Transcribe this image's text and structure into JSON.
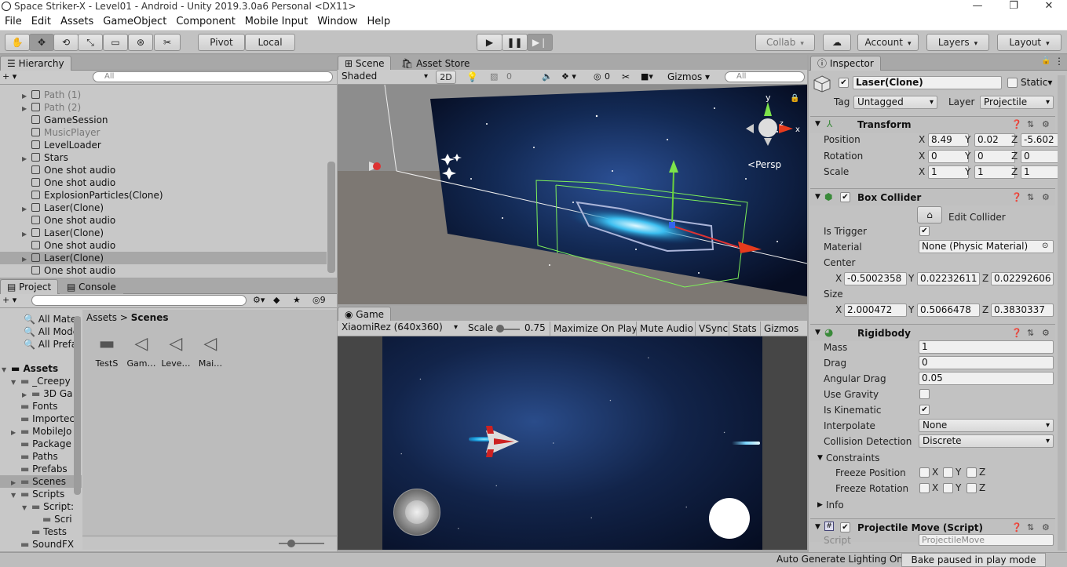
{
  "window": {
    "title": "Space Striker-X - Level01 - Android - Unity 2019.3.0a6 Personal <DX11>",
    "min": "—",
    "max": "❐",
    "close": "✕"
  },
  "menu": [
    "File",
    "Edit",
    "Assets",
    "GameObject",
    "Component",
    "Mobile Input",
    "Window",
    "Help"
  ],
  "toolbar": {
    "pivot": "Pivot",
    "local": "Local",
    "collab": "Collab",
    "account": "Account",
    "layers": "Layers",
    "layout": "Layout",
    "tools": [
      "✋",
      "✥",
      "⟲",
      "⤡",
      "▭",
      "⊛",
      "✂"
    ],
    "play": "▶",
    "pause": "❚❚",
    "step": "▶❘"
  },
  "hierarchy": {
    "tab": "Hierarchy",
    "create": "+ ▾",
    "search_placeholder": "All",
    "items": [
      {
        "label": "Path (1)",
        "arrow": "▶",
        "grey": true
      },
      {
        "label": "Path (2)",
        "arrow": "▶",
        "grey": true
      },
      {
        "label": "GameSession",
        "arrow": "",
        "grey": false
      },
      {
        "label": "MusicPlayer",
        "arrow": "",
        "grey": true
      },
      {
        "label": "LevelLoader",
        "arrow": "",
        "grey": false
      },
      {
        "label": "Stars",
        "arrow": "▶",
        "grey": false
      },
      {
        "label": "One shot audio",
        "arrow": "",
        "grey": false
      },
      {
        "label": "One shot audio",
        "arrow": "",
        "grey": false
      },
      {
        "label": "ExplosionParticles(Clone)",
        "arrow": "",
        "grey": false
      },
      {
        "label": "Laser(Clone)",
        "arrow": "▶",
        "grey": false
      },
      {
        "label": "One shot audio",
        "arrow": "",
        "grey": false
      },
      {
        "label": "Laser(Clone)",
        "arrow": "▶",
        "grey": false
      },
      {
        "label": "One shot audio",
        "arrow": "",
        "grey": false
      },
      {
        "label": "Laser(Clone)",
        "arrow": "▶",
        "grey": false,
        "selected": true
      },
      {
        "label": "One shot audio",
        "arrow": "",
        "grey": false
      }
    ]
  },
  "project": {
    "tab": "Project",
    "console_tab": "Console",
    "hidden_count": "9",
    "favorites": [
      "All Mater",
      "All Mode",
      "All Prefa"
    ],
    "assets_root": "Assets",
    "tree": [
      {
        "label": "_Creepy",
        "arrow": "▼",
        "indent": 1
      },
      {
        "label": "3D Ga",
        "arrow": "▶",
        "indent": 2
      },
      {
        "label": "Fonts",
        "arrow": "",
        "indent": 1
      },
      {
        "label": "Importec",
        "arrow": "",
        "indent": 1
      },
      {
        "label": "MobileJo",
        "arrow": "▶",
        "indent": 1
      },
      {
        "label": "Package",
        "arrow": "",
        "indent": 1
      },
      {
        "label": "Paths",
        "arrow": "",
        "indent": 1
      },
      {
        "label": "Prefabs",
        "arrow": "",
        "indent": 1
      },
      {
        "label": "Scenes",
        "arrow": "▶",
        "indent": 1,
        "selected": true
      },
      {
        "label": "Scripts",
        "arrow": "▼",
        "indent": 1
      },
      {
        "label": "Script:",
        "arrow": "▼",
        "indent": 2
      },
      {
        "label": "Scri",
        "arrow": "",
        "indent": 3
      },
      {
        "label": "Tests",
        "arrow": "",
        "indent": 2
      },
      {
        "label": "SoundFX",
        "arrow": "",
        "indent": 1
      }
    ],
    "breadcrumb_root": "Assets",
    "breadcrumb_sep": ">",
    "breadcrumb_current": "Scenes",
    "files": [
      {
        "label": "TestS",
        "kind": "folder"
      },
      {
        "label": "Gam…",
        "kind": "unity"
      },
      {
        "label": "Leve…",
        "kind": "unity"
      },
      {
        "label": "Mai…",
        "kind": "unity"
      }
    ]
  },
  "scene": {
    "tab": "Scene",
    "store_tab": "Asset Store",
    "shading": "Shaded",
    "mode_2d": "2D",
    "fx_count": "0",
    "hidden": "0",
    "gizmos": "Gizmos",
    "search_placeholder": "All",
    "persp": "Persp",
    "axis_y": "y",
    "axis_x": "x",
    "axis_z": "z"
  },
  "game": {
    "tab": "Game",
    "resolution": "XiaomiRez (640x360)",
    "scale_label": "Scale",
    "scale_value": "0.75",
    "maximize": "Maximize On Play",
    "mute": "Mute Audio",
    "vsync": "VSync",
    "stats": "Stats",
    "gizmos": "Gizmos"
  },
  "inspector": {
    "tab": "Inspector",
    "object_name": "Laser(Clone)",
    "static_label": "Static",
    "tag_label": "Tag",
    "tag": "Untagged",
    "layer_label": "Layer",
    "layer": "Projectile",
    "transform": {
      "title": "Transform",
      "position_label": "Position",
      "rotation_label": "Rotation",
      "scale_label": "Scale",
      "position": [
        "8.49",
        "0.02",
        "-5.602"
      ],
      "rotation": [
        "0",
        "0",
        "0"
      ],
      "scale": [
        "1",
        "1",
        "1"
      ]
    },
    "box_collider": {
      "title": "Box Collider",
      "edit": "Edit Collider",
      "is_trigger": "Is Trigger",
      "material_label": "Material",
      "material": "None (Physic Material)",
      "center_label": "Center",
      "center": [
        "-0.5002358",
        "0.02232611",
        "0.02292606"
      ],
      "size_label": "Size",
      "size": [
        "2.000472",
        "0.5066478",
        "0.3830337"
      ]
    },
    "rigidbody": {
      "title": "Rigidbody",
      "mass_label": "Mass",
      "mass": "1",
      "drag_label": "Drag",
      "drag": "0",
      "angular_label": "Angular Drag",
      "angular": "0.05",
      "gravity_label": "Use Gravity",
      "kinematic_label": "Is Kinematic",
      "interpolate_label": "Interpolate",
      "interpolate": "None",
      "collision_label": "Collision Detection",
      "collision": "Discrete",
      "constraints": "Constraints",
      "freeze_pos": "Freeze Position",
      "freeze_rot": "Freeze Rotation",
      "info": "Info"
    },
    "projectile": {
      "title": "Projectile Move (Script)",
      "script_label": "Script",
      "script": "ProjectileMove"
    },
    "axes": [
      "X",
      "Y",
      "Z"
    ]
  },
  "status": {
    "lighting": "Auto Generate Lighting On",
    "bake": "Bake paused in play mode"
  }
}
